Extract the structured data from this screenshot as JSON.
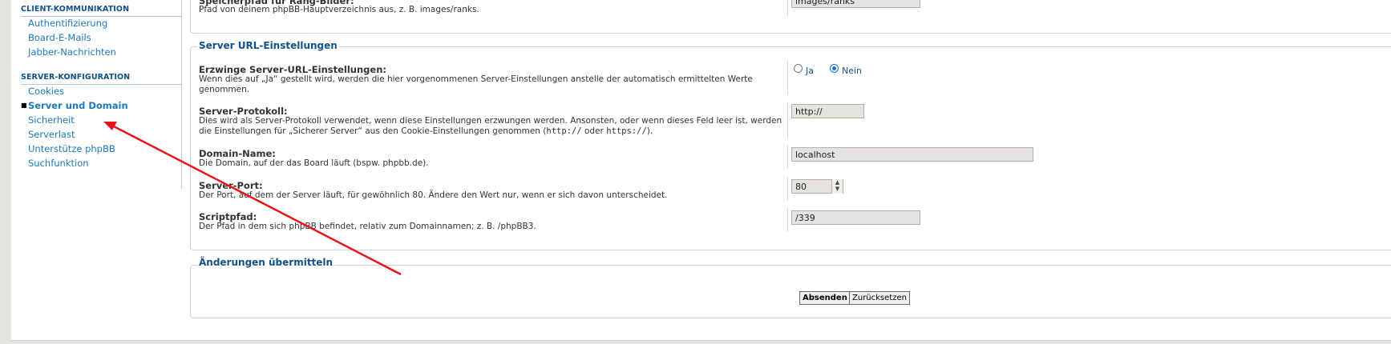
{
  "sidebar": {
    "sections": [
      {
        "heading": "CLIENT-KOMMUNIKATION",
        "items": [
          "Authentifizierung",
          "Board-E-Mails",
          "Jabber-Nachrichten"
        ]
      },
      {
        "heading": "SERVER-KONFIGURATION",
        "items": [
          "Cookies",
          "Server und Domain",
          "Sicherheit",
          "Serverlast",
          "Unterstütze phpBB",
          "Suchfunktion"
        ]
      }
    ],
    "active_item": "Server und Domain"
  },
  "top_fieldset": {
    "title": "Speicherpfad für Rang-Bilder:",
    "desc": "Pfad von deinem phpBB-Hauptverzeichnis aus, z. B. images/ranks.",
    "value": "images/ranks"
  },
  "server_url": {
    "legend": "Server URL-Einstellungen",
    "force": {
      "title": "Erzwinge Server-URL-Einstellungen:",
      "desc": "Wenn dies auf „Ja“ gestellt wird, werden die hier vorgenommenen Server-Einstellungen anstelle der automatisch ermittelten Werte genommen.",
      "options": [
        "Ja",
        "Nein"
      ],
      "selected": "Nein"
    },
    "protocol": {
      "title": "Server-Protokoll:",
      "desc_a": "Dies wird als Server-Protokoll verwendet, wenn diese Einstellungen erzwungen werden. Ansonsten, oder wenn dieses Feld leer ist, werden die Einstellungen für „Sicherer Server“ aus den Cookie-Einstellungen genommen (",
      "code1": "http://",
      "desc_b": " oder ",
      "code2": "https://",
      "desc_c": ").",
      "value": "http://"
    },
    "domain": {
      "title": "Domain-Name:",
      "desc": "Die Domain, auf der das Board läuft (bspw. phpbb.de).",
      "value": "localhost"
    },
    "port": {
      "title": "Server-Port:",
      "desc": "Der Port, auf dem der Server läuft, für gewöhnlich 80. Ändere den Wert nur, wenn er sich davon unterscheidet.",
      "value": "80"
    },
    "script_path": {
      "title": "Scriptpfad:",
      "desc": "Der Pfad in dem sich phpBB befindet, relativ zum Domainnamen; z. B. /phpBB3.",
      "value": "/339"
    }
  },
  "submit": {
    "legend": "Änderungen übermitteln",
    "submit_label": "Absenden",
    "reset_label": "Zurücksetzen"
  },
  "colors": {
    "link": "#1d79b8",
    "heading": "#105289",
    "annotation_arrow": "#e8141a"
  }
}
